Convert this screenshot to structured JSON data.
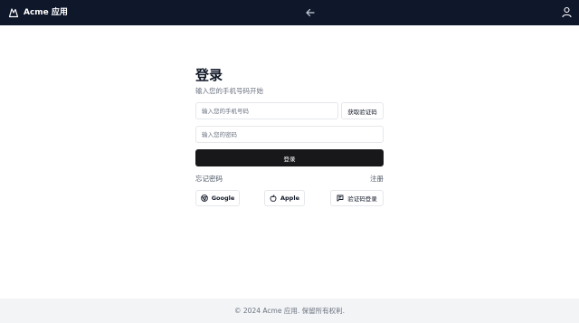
{
  "header": {
    "brand_name": "Acme 应用",
    "logo_icon": "triangle-logo-icon",
    "back_icon": "arrow-left-icon",
    "user_icon": "user-icon"
  },
  "login": {
    "title": "登录",
    "subtitle": "输入您的手机号码开始",
    "phone_placeholder": "输入您的手机号码",
    "get_code_label": "获取验证码",
    "password_placeholder": "输入您的密码",
    "submit_label": "登录",
    "forgot_label": "忘记密码",
    "register_label": "注册",
    "social": [
      {
        "label": "Google",
        "icon": "chrome-icon"
      },
      {
        "label": "Apple",
        "icon": "apple-icon"
      },
      {
        "label": "验证码登录",
        "icon": "message-icon"
      }
    ]
  },
  "footer": {
    "text": "© 2024 Acme 应用. 保留所有权利."
  },
  "colors": {
    "header_bg": "#0f172a",
    "primary_button": "#18181b",
    "footer_bg": "#f3f4f6"
  }
}
